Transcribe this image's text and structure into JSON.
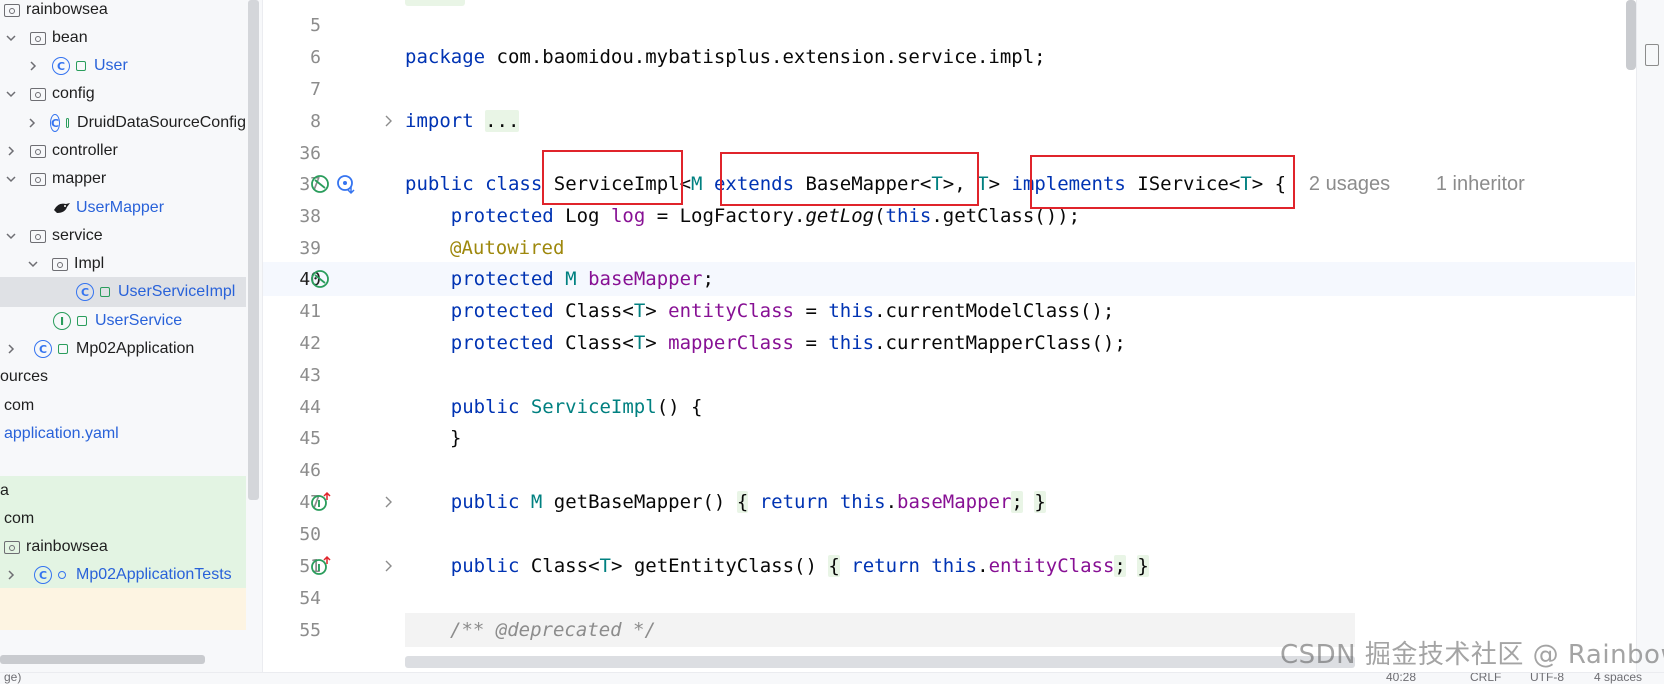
{
  "project_tree": {
    "rows": [
      {
        "label": "rainbowsea"
      },
      {
        "label": "bean"
      },
      {
        "label": "User"
      },
      {
        "label": "config"
      },
      {
        "label": "DruidDataSourceConfig"
      },
      {
        "label": "controller"
      },
      {
        "label": "mapper"
      },
      {
        "label": "UserMapper"
      },
      {
        "label": "service"
      },
      {
        "label": "Impl"
      },
      {
        "label": "UserServiceImpl"
      },
      {
        "label": "UserService"
      },
      {
        "label": "Mp02Application"
      },
      {
        "label": "ources"
      },
      {
        "label": "com"
      },
      {
        "label": "application.yaml"
      },
      {
        "label": "a"
      },
      {
        "label": "com"
      },
      {
        "label": "rainbowsea"
      },
      {
        "label": "Mp02ApplicationTests"
      }
    ]
  },
  "editor": {
    "line_numbers": [
      "5",
      "6",
      "7",
      "8",
      "36",
      "37",
      "38",
      "39",
      "40",
      "41",
      "42",
      "43",
      "44",
      "45",
      "46",
      "47",
      "50",
      "51",
      "54",
      "55"
    ],
    "package_line": "package com.baomidou.mybatisplus.extension.service.impl;",
    "import_line": "import ...",
    "class_decl": {
      "public": "public",
      "class": "class",
      "name": "ServiceImpl",
      "generic_m": "M",
      "extends": "extends",
      "base_mapper": "BaseMapper",
      "t": "T",
      "implements": "implements",
      "iservice": "IService",
      "usages_hint": "2 usages",
      "inheritor_hint": "1 inheritor"
    },
    "log_line": {
      "protected": "protected",
      "type": "Log",
      "field": "log",
      "factory": "LogFactory",
      "method": "getLog",
      "this": "this",
      "rest": ".getClass());"
    },
    "autowired": "@Autowired",
    "basemapper_field": {
      "protected": "protected",
      "type": "M",
      "field": "baseMapper"
    },
    "entity_line": {
      "protected": "protected",
      "type": "Class",
      "field": "entityClass",
      "this": "this",
      "call": ".currentModelClass();"
    },
    "mapper_line": {
      "protected": "protected",
      "type": "Class",
      "field": "mapperClass",
      "this": "this",
      "call": ".currentMapperClass();"
    },
    "constructor": {
      "public": "public",
      "name": "ServiceImpl",
      "rest": "() {"
    },
    "close_brace": "}",
    "get_base_mapper": {
      "public": "public",
      "type": "M",
      "name": "getBaseMapper",
      "return": "return",
      "this": "this",
      "field": "baseMapper"
    },
    "get_entity_class": {
      "public": "public",
      "type": "Class",
      "name": "getEntityClass",
      "return": "return",
      "this": "this",
      "field": "entityClass"
    },
    "deprecated_comment": "/** @deprecated */"
  },
  "statusbar": {
    "left": "ge)",
    "position": "40:28",
    "line_sep": "CRLF",
    "encoding": "UTF-8",
    "indent": "4 spaces"
  },
  "watermark": "CSDN 掘金技术社区 @ RainbowSea"
}
